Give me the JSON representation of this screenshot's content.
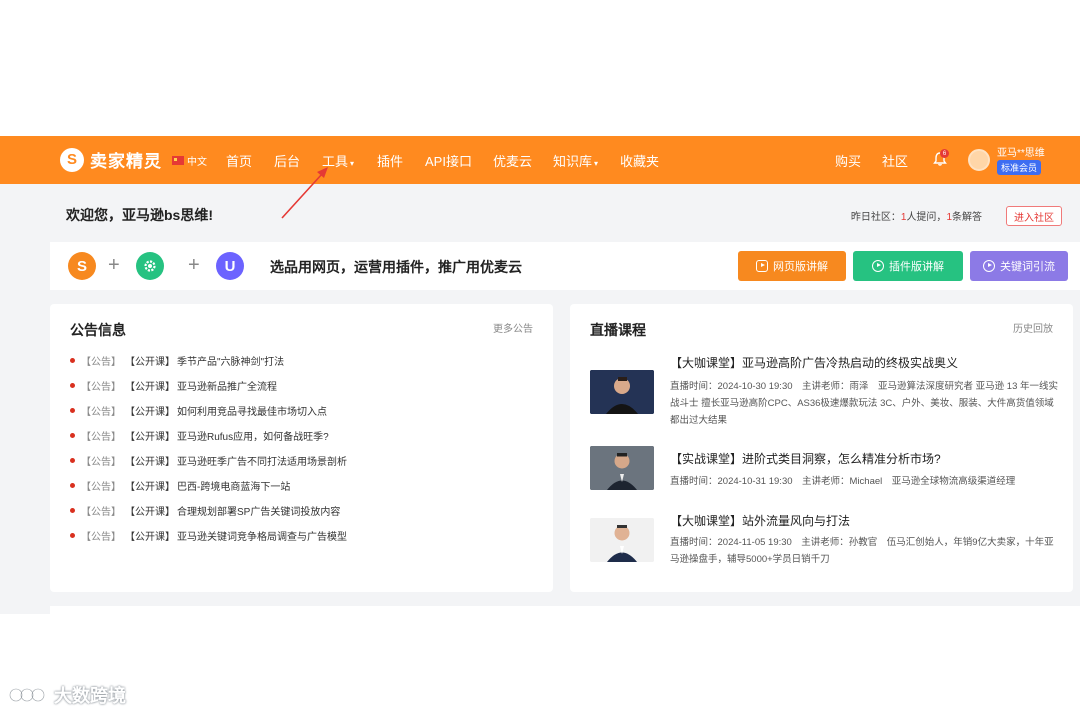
{
  "nav": {
    "logo_text": "卖家精灵",
    "lang": "中文",
    "items": [
      "首页",
      "后台",
      "工具",
      "插件",
      "API接口",
      "优麦云",
      "知识库",
      "收藏夹"
    ],
    "right_items": [
      "购买",
      "社区"
    ],
    "notification_count": "6",
    "user_name": "亚马**思维",
    "user_badge": "标准会员"
  },
  "welcome": {
    "text": "欢迎您，亚马逊bs思维!",
    "stats_label": "昨日社区：",
    "stats_q_num": "1",
    "stats_q_text": "人提问，",
    "stats_a_num": "1",
    "stats_a_text": "条解答",
    "enter_button": "进入社区"
  },
  "tools_bar": {
    "slogan": "选品用网页，运营用插件，推广用优麦云",
    "buttons": [
      "网页版讲解",
      "插件版讲解",
      "关键词引流"
    ],
    "colors": {
      "web": "#f7891f",
      "plugin": "#26c281",
      "keyword": "#8c7ae6"
    }
  },
  "announcements": {
    "title": "公告信息",
    "more": "更多公告",
    "tag": "【公告】",
    "category": "【公开课】",
    "items": [
      "季节产品\"六脉神剑\"打法",
      "亚马逊新品推广全流程",
      "如何利用竞品寻找最佳市场切入点",
      "亚马逊Rufus应用，如何备战旺季?",
      "亚马逊旺季广告不同打法适用场景剖析",
      "巴西-跨境电商蓝海下一站",
      "合理规划部署SP广告关键词投放内容",
      "亚马逊关键词竞争格局调查与广告模型"
    ]
  },
  "live_courses": {
    "title": "直播课程",
    "more": "历史回放",
    "courses": [
      {
        "title": "【大咖课堂】亚马逊高阶广告冷热启动的终极实战奥义",
        "meta": "直播时间：2024-10-30 19:30　主讲老师：雨泽　亚马逊算法深度研究者 亚马逊 13 年一线实战斗士 擅长亚马逊高阶CPC、AS36极速爆款玩法 3C、户外、美妆、服装、大件高货值领域都出过大结果"
      },
      {
        "title": "【实战课堂】进阶式类目洞察，怎么精准分析市场?",
        "meta": "直播时间：2024-10-31 19:30　主讲老师：Michael　亚马逊全球物流高级渠道经理"
      },
      {
        "title": "【大咖课堂】站外流量风向与打法",
        "meta": "直播时间：2024-11-05 19:30　主讲老师：孙教官　伍马汇创始人，年销9亿大卖家，十年亚马逊操盘手，辅导5000+学员日销千刀"
      }
    ]
  },
  "watermark": "大数跨境"
}
